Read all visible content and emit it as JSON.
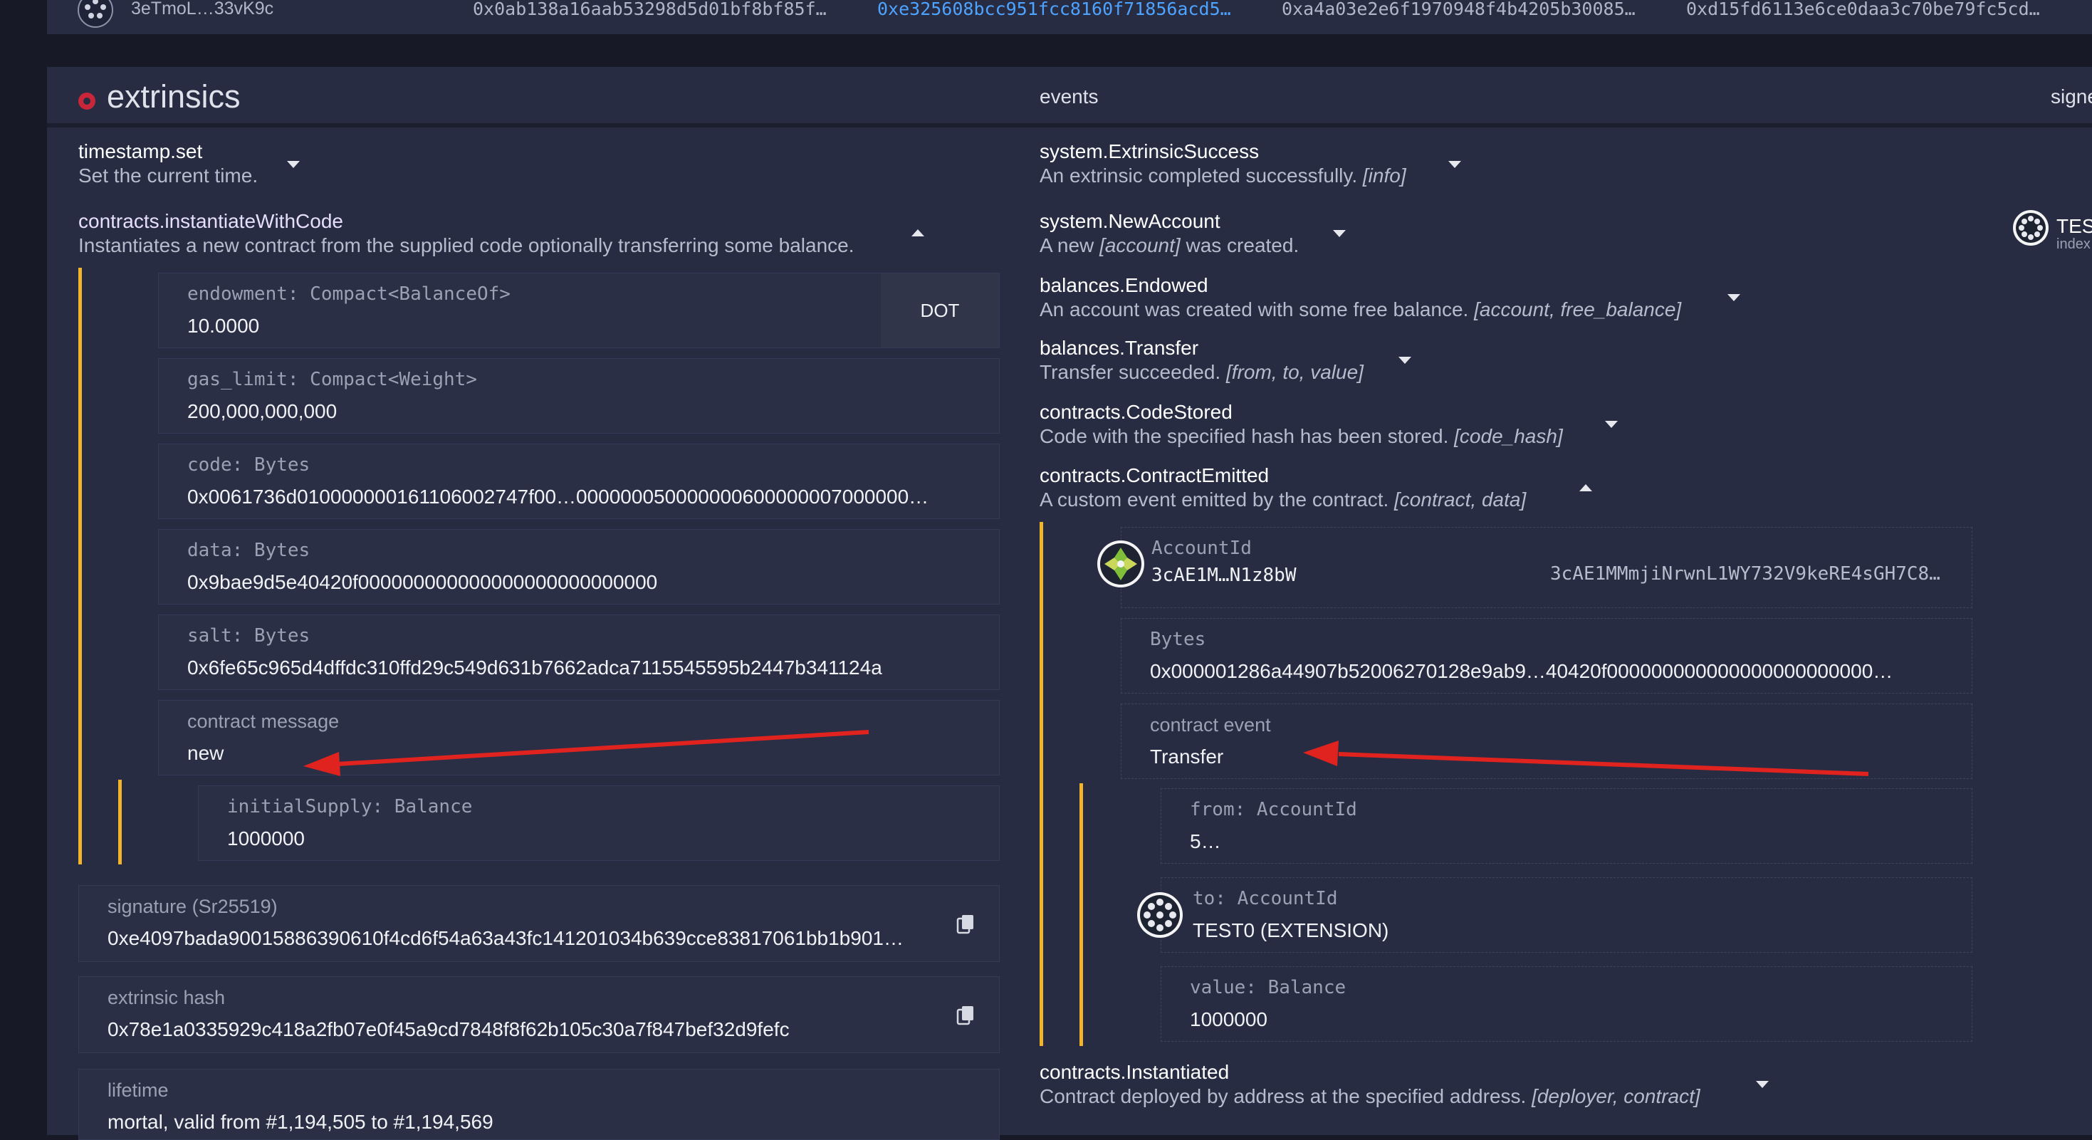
{
  "topbar": {
    "account": "3eTmoL…33vK9c",
    "hashes": [
      "0x0ab138a16aab53298d5d01bf8bf85f…",
      "0xe325608bcc951fcc8160f71856acd5…",
      "0xa4a03e2e6f1970948f4b4205b30085…",
      "0xd15fd6113e6ce0daa3c70be79fc5cd…"
    ]
  },
  "header": {
    "extrinsics_title": "extrinsics",
    "events_label": "events",
    "signer_label": "signe"
  },
  "extrinsics": {
    "items": [
      {
        "title": "timestamp.set",
        "desc": "Set the current time."
      },
      {
        "title": "contracts.instantiateWithCode",
        "desc": "Instantiates a new contract from the supplied code optionally transferring some balance."
      }
    ],
    "params": {
      "endowment": {
        "label": "endowment: Compact<BalanceOf>",
        "value": "10.0000",
        "unit": "DOT"
      },
      "gas_limit": {
        "label": "gas_limit: Compact<Weight>",
        "value": "200,000,000,000"
      },
      "code": {
        "label": "code: Bytes",
        "value": "0x0061736d010000000161106002747f00…000000050000000600000007000000…"
      },
      "data": {
        "label": "data: Bytes",
        "value": "0x9bae9d5e40420f000000000000000000000000000"
      },
      "salt": {
        "label": "salt: Bytes",
        "value": "0x6fe65c965d4dffdc310ffd29c549d631b7662adca7115545595b2447b341124a"
      },
      "contract_message": {
        "label": "contract message",
        "value": "new"
      },
      "initial_supply": {
        "label": "initialSupply: Balance",
        "value": "1000000"
      }
    },
    "signature": {
      "label": "signature (Sr25519)",
      "value": "0xe4097bada90015886390610f4cd6f54a63a43fc141201034b639cce83817061bb1b901…"
    },
    "extrinsic_hash": {
      "label": "extrinsic hash",
      "value": "0x78e1a0335929c418a2fb07e0f45a9cd7848f8f62b105c30a7f847bef32d9fefc"
    },
    "lifetime": {
      "label": "lifetime",
      "value": "mortal, valid from #1,194,505 to #1,194,569"
    }
  },
  "events": {
    "items": [
      {
        "title": "system.ExtrinsicSuccess",
        "desc": "An extrinsic completed successfully.",
        "args": "[info]"
      },
      {
        "title": "system.NewAccount",
        "desc_pre": "A new",
        "args": "[account]",
        "desc_post": "was created."
      },
      {
        "title": "balances.Endowed",
        "desc": "An account was created with some free balance.",
        "args": "[account, free_balance]"
      },
      {
        "title": "balances.Transfer",
        "desc": "Transfer succeeded.",
        "args": "[from, to, value]"
      },
      {
        "title": "contracts.CodeStored",
        "desc": "Code with the specified hash has been stored.",
        "args": "[code_hash]"
      },
      {
        "title": "contracts.ContractEmitted",
        "desc": "A custom event emitted by the contract.",
        "args": "[contract, data]"
      },
      {
        "title": "contracts.Instantiated",
        "desc": "Contract deployed by address at the specified address.",
        "args": "[deployer, contract]"
      }
    ],
    "emitted": {
      "account_label": "AccountId",
      "account_short": "3cAE1M…N1z8bW",
      "account_long": "3cAE1MMmjiNrwnL1WY732V9keRE4sGH7C8…",
      "bytes_label": "Bytes",
      "bytes_value": "0x000001286a44907b52006270128e9ab9…40420f000000000000000000000000…",
      "contract_event_label": "contract event",
      "contract_event_value": "Transfer",
      "from_label": "from: AccountId",
      "from_value": "5…",
      "to_label": "to: AccountId",
      "to_value": "TEST0 (EXTENSION)",
      "value_label": "value: Balance",
      "value_value": "1000000"
    }
  },
  "signer": {
    "name": "TES",
    "sub": "index"
  },
  "colors": {
    "accent": "#f2b42b",
    "arrow": "#e0231e",
    "link": "#4ea3ff",
    "panel": "#272c43"
  }
}
